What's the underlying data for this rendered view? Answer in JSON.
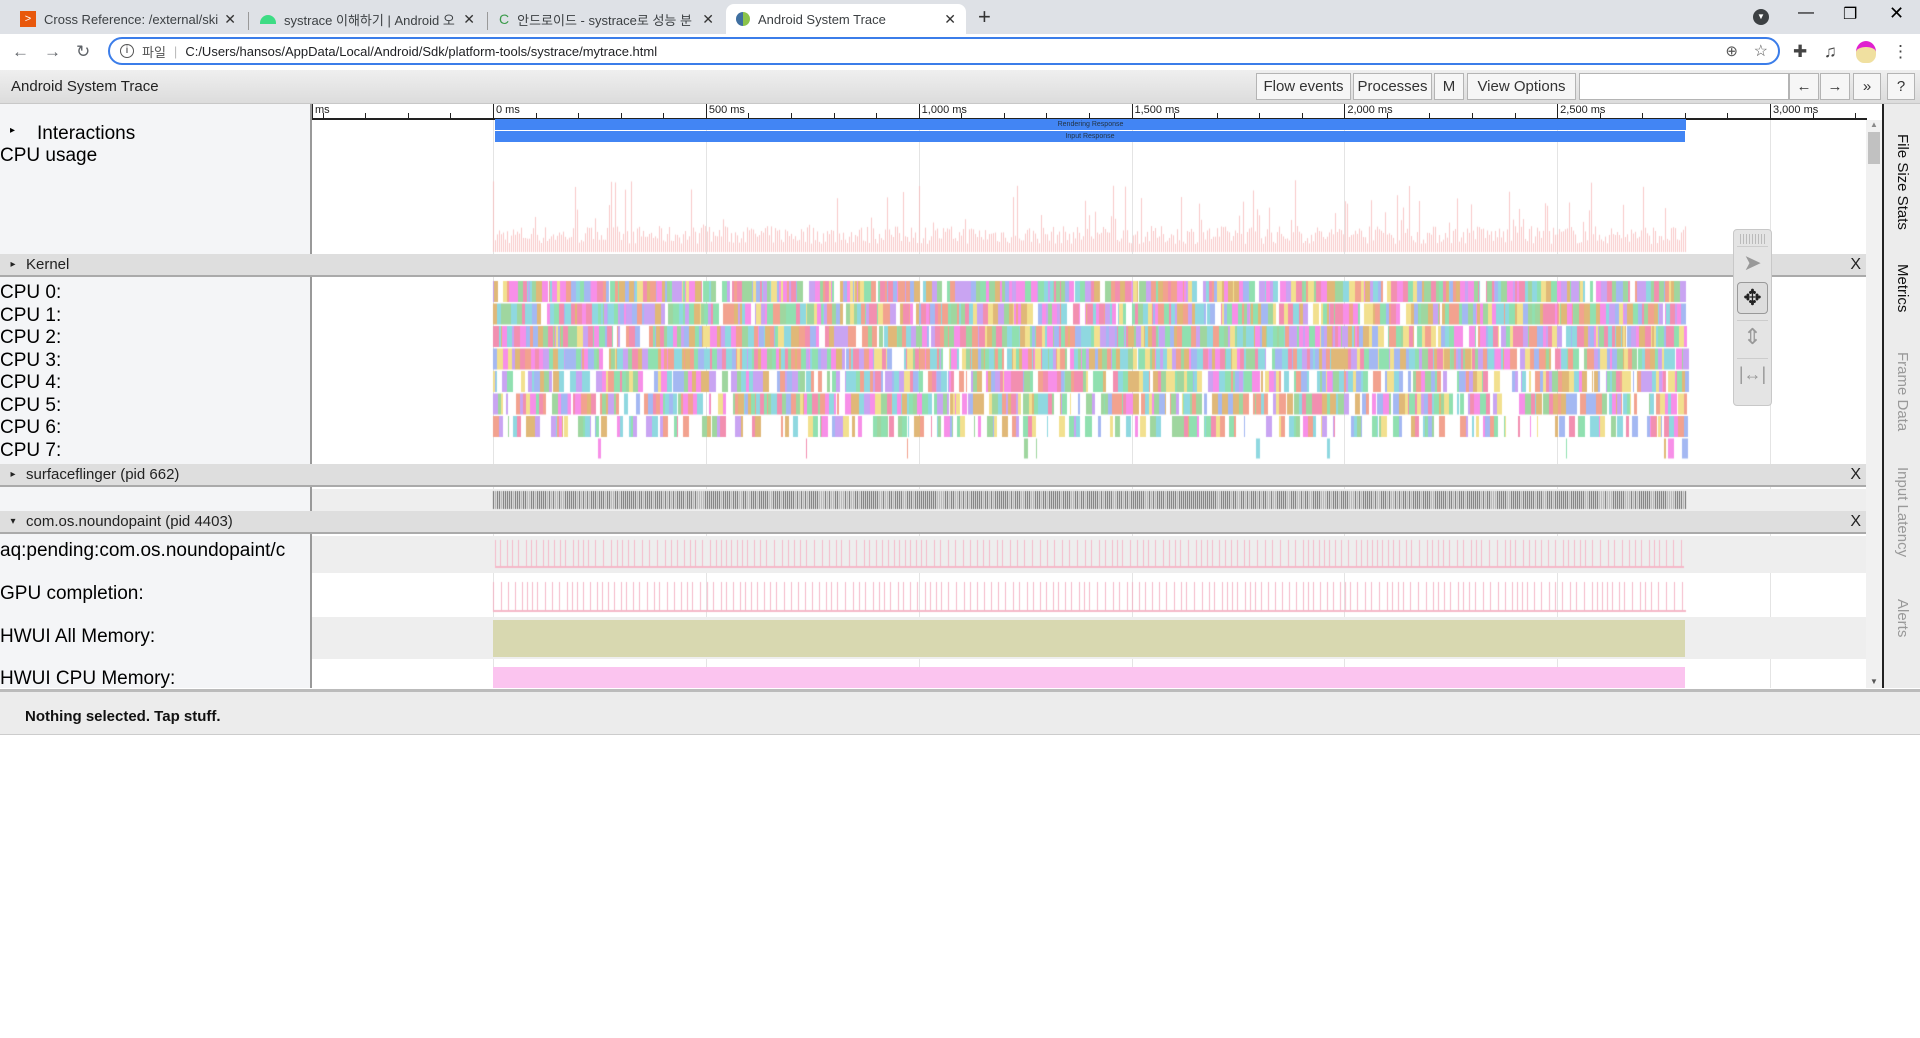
{
  "browser": {
    "tabs": [
      {
        "title": "Cross Reference: /external/skia/",
        "icon": "opengrok-icon",
        "active": false
      },
      {
        "title": "systrace 이해하기 | Android 오",
        "icon": "android-icon",
        "active": false
      },
      {
        "title": "안드로이드 - systrace로 성능 분",
        "icon": "c-logo-icon",
        "active": false
      },
      {
        "title": "Android System Trace",
        "icon": "trace-icon",
        "active": true
      }
    ],
    "new_tab": "+",
    "address": {
      "scheme_label": "파일",
      "url": "C:/Users/hansos/AppData/Local/Android/Sdk/platform-tools/systrace/mytrace.html"
    }
  },
  "app": {
    "title": "Android System Trace",
    "buttons": {
      "flow_events": "Flow events",
      "processes": "Processes",
      "m": "M",
      "view_options": "View Options",
      "back": "←",
      "forward": "→",
      "more": "»",
      "help": "?"
    },
    "search_value": ""
  },
  "ruler": {
    "ticks": [
      "ms",
      "0 ms",
      "500 ms",
      "1,000 ms",
      "1,500 ms",
      "2,000 ms",
      "2,500 ms",
      "3,000 ms"
    ]
  },
  "interactions": {
    "label": "Interactions",
    "bars": [
      "Rendering Response",
      "Input Response"
    ]
  },
  "cpu_usage": {
    "label": "CPU usage"
  },
  "kernel": {
    "header": "Kernel",
    "close": "X",
    "cpus": [
      "CPU 0:",
      "CPU 1:",
      "CPU 2:",
      "CPU 3:",
      "CPU 4:",
      "CPU 5:",
      "CPU 6:",
      "CPU 7:"
    ]
  },
  "surfaceflinger": {
    "header": "surfaceflinger (pid 662)",
    "close": "X"
  },
  "process": {
    "header": "com.os.noundopaint (pid 4403)",
    "close": "X",
    "tracks": [
      "aq:pending:com.os.noundopaint/c",
      "GPU completion:",
      "HWUI All Memory:",
      "HWUI CPU Memory:"
    ]
  },
  "side_tabs": [
    "File Size Stats",
    "Metrics",
    "Frame Data",
    "Input Latency",
    "Alerts"
  ],
  "status": "Nothing selected. Tap stuff.",
  "colors": {
    "accent": "#4285f4",
    "cpu_usage": "#f9c8c8",
    "hwui_all": "#d8d8b0",
    "hwui_cpu": "#fbc4ef"
  }
}
